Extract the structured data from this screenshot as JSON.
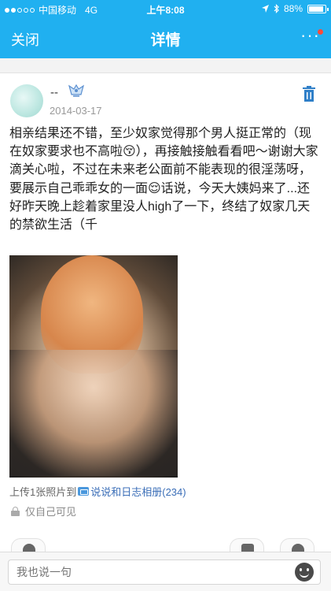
{
  "status_bar": {
    "carrier": "中国移动",
    "network": "4G",
    "time": "上午8:08",
    "battery": "88%",
    "battery_level": 0.88
  },
  "nav": {
    "close_label": "关闭",
    "title": "详情",
    "more_label": "···"
  },
  "post": {
    "nickname": "--",
    "date": "2014-03-17",
    "content": "相亲结果还不错，至少奴家觉得那个男人挺正常的（现在奴家要求也不高啦😚），再接触接触看看吧～谢谢大家滴关心啦，不过在未来老公面前不能表现的很淫荡呀，要展示自己乖乖女的一面😌话说，今天大姨妈来了...还好昨天晚上趁着家里没人high了一下，终结了奴家几天的禁欲生活（千",
    "upload_prefix": "上传1张照片到",
    "album_link": "说说和日志相册(234)",
    "privacy": "仅自己可见"
  },
  "comment_bar": {
    "placeholder": "我也说一句"
  },
  "colors": {
    "nav_background": "#20b0f0",
    "link": "#3c6fb8",
    "badge": "#ff4a3a"
  },
  "icons": [
    "signal-dots-icon",
    "location-icon",
    "bluetooth-icon",
    "battery-icon",
    "more-icon",
    "vip-badge-icon",
    "trash-icon",
    "album-icon",
    "lock-icon",
    "share-icon",
    "like-icon",
    "comment-icon",
    "emoji-icon"
  ]
}
